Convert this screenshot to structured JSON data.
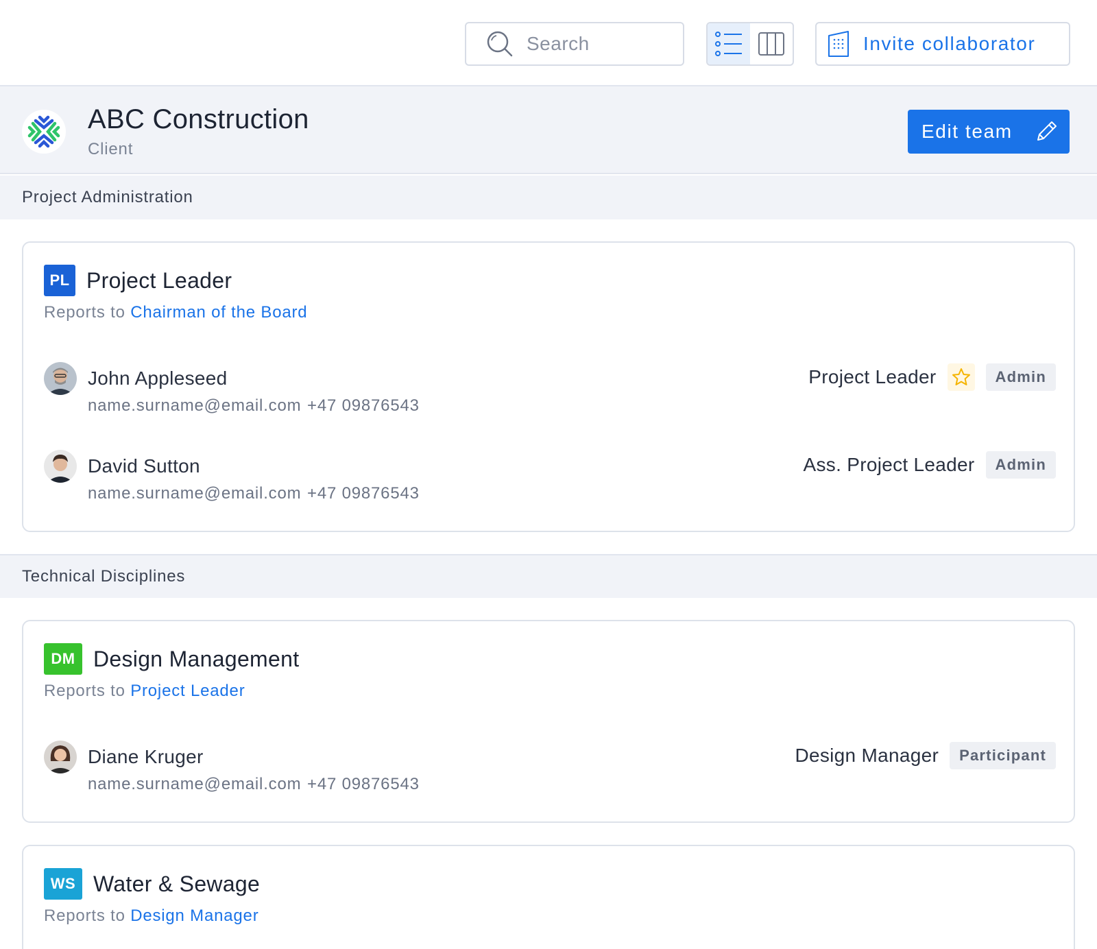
{
  "toolbar": {
    "search_placeholder": "Search",
    "invite_label": "Invite collaborator",
    "view_modes": [
      {
        "icon": "list-view-icon",
        "active": true
      },
      {
        "icon": "columns-view-icon",
        "active": false
      }
    ]
  },
  "client": {
    "name": "ABC Construction",
    "role": "Client",
    "edit_label": "Edit team"
  },
  "sections": [
    {
      "title": "Project Administration",
      "cards": [
        {
          "badge": "PL",
          "badge_color": "#1a62d6",
          "title": "Project Leader",
          "reports_prefix": "Reports to",
          "reports_to": "Chairman of the Board",
          "members": [
            {
              "name": "John Appleseed",
              "email": "name.surname@email.com",
              "phone": "+47 09876543",
              "role": "Project Leader",
              "starred": true,
              "permission": "Admin"
            },
            {
              "name": "David Sutton",
              "email": "name.surname@email.com",
              "phone": "+47 09876543",
              "role": "Ass. Project Leader",
              "starred": false,
              "permission": "Admin"
            }
          ]
        }
      ]
    },
    {
      "title": "Technical Disciplines",
      "cards": [
        {
          "badge": "DM",
          "badge_color": "#37c22d",
          "title": "Design Management",
          "reports_prefix": "Reports to",
          "reports_to": "Project Leader",
          "members": [
            {
              "name": "Diane Kruger",
              "email": "name.surname@email.com",
              "phone": "+47 09876543",
              "role": "Design Manager",
              "starred": false,
              "permission": "Participant"
            }
          ]
        },
        {
          "badge": "WS",
          "badge_color": "#1aa3d6",
          "title": "Water & Sewage",
          "reports_prefix": "Reports to",
          "reports_to": "Design Manager",
          "members": []
        }
      ]
    }
  ],
  "colors": {
    "accent": "#1a73e8",
    "logo_blue": "#2a57d6",
    "logo_green": "#2ec46a",
    "star": "#f5b400"
  }
}
